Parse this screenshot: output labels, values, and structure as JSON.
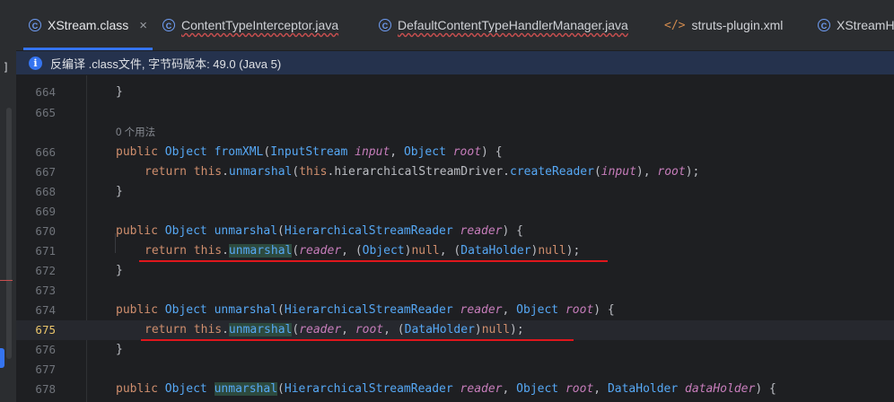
{
  "tabs": [
    {
      "label": "XStream.class",
      "icon": "class-icon",
      "active": true,
      "close": "×"
    },
    {
      "label": "ContentTypeInterceptor.java",
      "icon": "class-icon",
      "error": true
    },
    {
      "label": "DefaultContentTypeHandlerManager.java",
      "icon": "class-icon",
      "error": true
    },
    {
      "label": "struts-plugin.xml",
      "icon": "xml-icon"
    },
    {
      "label": "XStreamHa",
      "icon": "class-icon"
    }
  ],
  "banner": {
    "icon": "i",
    "text": "反编译 .class文件, 字节码版本: 49.0 (Java 5)"
  },
  "left_strip": {
    "bracket": "]"
  },
  "hint": "0 个用法",
  "lines": [
    {
      "num": "664",
      "code": "}"
    },
    {
      "num": "665",
      "code": ""
    },
    {
      "num": "666",
      "code": "public Object fromXML(InputStream input, Object root) {"
    },
    {
      "num": "667",
      "code": "return this.unmarshal(this.hierarchicalStreamDriver.createReader(input), root);"
    },
    {
      "num": "668",
      "code": "}"
    },
    {
      "num": "669",
      "code": ""
    },
    {
      "num": "670",
      "code": "public Object unmarshal(HierarchicalStreamReader reader) {"
    },
    {
      "num": "671",
      "code": "return this.unmarshal(reader, (Object)null, (DataHolder)null);"
    },
    {
      "num": "672",
      "code": "}"
    },
    {
      "num": "673",
      "code": ""
    },
    {
      "num": "674",
      "code": "public Object unmarshal(HierarchicalStreamReader reader, Object root) {"
    },
    {
      "num": "675",
      "code": "return this.unmarshal(reader, root, (DataHolder)null);"
    },
    {
      "num": "676",
      "code": "}"
    },
    {
      "num": "677",
      "code": ""
    },
    {
      "num": "678",
      "code": "public Object unmarshal(HierarchicalStreamReader reader, Object root, DataHolder dataHolder) {"
    }
  ],
  "current_line": "675",
  "colors": {
    "keyword": "#cf8e6d",
    "type": "#56a8f5",
    "param": "#c77dbb",
    "annotation_underline": "#e0161c",
    "accent": "#3574f0"
  }
}
